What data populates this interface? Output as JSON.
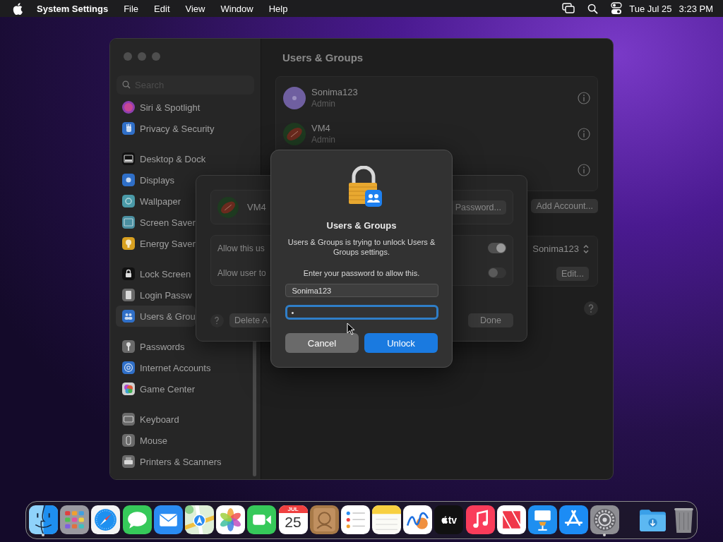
{
  "menu_bar": {
    "app": "System Settings",
    "menus": [
      "File",
      "Edit",
      "View",
      "Window",
      "Help"
    ],
    "date": "Tue Jul 25",
    "time": "3:23 PM"
  },
  "sidebar": {
    "search": {
      "placeholder": "Search"
    },
    "groups": [
      {
        "items": [
          {
            "label": "Siri & Spotlight",
            "color": "#8e3fb0",
            "selected": false
          },
          {
            "label": "Privacy & Security",
            "color": "#2f6fc8",
            "selected": false
          }
        ]
      },
      {
        "items": [
          {
            "label": "Desktop & Dock",
            "color": "#111111",
            "selected": false
          },
          {
            "label": "Displays",
            "color": "#2f6fc8",
            "selected": false
          },
          {
            "label": "Wallpaper",
            "color": "#4a9aa8",
            "selected": false
          },
          {
            "label": "Screen Saver",
            "color": "#4a8fa0",
            "selected": false
          },
          {
            "label": "Energy Saver",
            "color": "#d8a020",
            "selected": false
          }
        ]
      },
      {
        "items": [
          {
            "label": "Lock Screen",
            "color": "#111111",
            "selected": false
          },
          {
            "label": "Login Passw",
            "color": "#6a6a6a",
            "selected": false
          },
          {
            "label": "Users & Grou",
            "color": "#2f6fc8",
            "selected": true
          }
        ]
      },
      {
        "items": [
          {
            "label": "Passwords",
            "color": "#6a6a6a",
            "selected": false
          },
          {
            "label": "Internet Accounts",
            "color": "#2f6fc8",
            "selected": false
          },
          {
            "label": "Game Center",
            "color": "#d0d0d0",
            "selected": false
          }
        ]
      },
      {
        "items": [
          {
            "label": "Keyboard",
            "color": "#6a6a6a",
            "selected": false
          },
          {
            "label": "Mouse",
            "color": "#6a6a6a",
            "selected": false
          },
          {
            "label": "Printers & Scanners",
            "color": "#6a6a6a",
            "selected": false
          }
        ]
      }
    ]
  },
  "content": {
    "title": "Users & Groups",
    "users": [
      {
        "kind": "user",
        "name": "Sonima123",
        "role": "Admin"
      },
      {
        "kind": "user",
        "name": "VM4",
        "role": "Admin"
      },
      {
        "kind": "covered"
      }
    ],
    "add_account_button": "Add Account...",
    "login_popup": "Sonima123",
    "edit_button": "Edit..."
  },
  "sheet": {
    "user": "VM4",
    "password_button": "Password...",
    "options": [
      {
        "label": "Allow this us",
        "on": true
      },
      {
        "label": "Allow user to",
        "on": false
      }
    ],
    "delete_button": "Delete A",
    "done_button": "Done"
  },
  "dialog": {
    "title": "Users & Groups",
    "message": "Users & Groups is trying to unlock Users & Groups settings.",
    "prompt": "Enter your password to allow this.",
    "username": "Sonima123",
    "password": "•",
    "cancel_button": "Cancel",
    "unlock_button": "Unlock"
  },
  "dock": {
    "items": [
      {
        "kind": "finder",
        "running": true
      },
      {
        "kind": "launchpad",
        "running": false
      },
      {
        "kind": "safari",
        "running": false
      },
      {
        "kind": "messages",
        "running": false
      },
      {
        "kind": "mail",
        "running": false
      },
      {
        "kind": "maps",
        "running": false
      },
      {
        "kind": "photos",
        "running": false
      },
      {
        "kind": "facetime",
        "running": false
      },
      {
        "kind": "calendar",
        "running": false,
        "month": "JUL",
        "day": "25"
      },
      {
        "kind": "contacts",
        "running": false
      },
      {
        "kind": "reminders",
        "running": false
      },
      {
        "kind": "notes",
        "running": false
      },
      {
        "kind": "freeform",
        "running": false
      },
      {
        "kind": "tv",
        "running": false,
        "label": "tv"
      },
      {
        "kind": "music",
        "running": false
      },
      {
        "kind": "news",
        "running": false
      },
      {
        "kind": "keynote",
        "running": false
      },
      {
        "kind": "appstore",
        "running": false
      },
      {
        "kind": "settings",
        "running": true
      }
    ],
    "stacks": [
      {
        "kind": "downloads"
      },
      {
        "kind": "trash"
      }
    ]
  }
}
